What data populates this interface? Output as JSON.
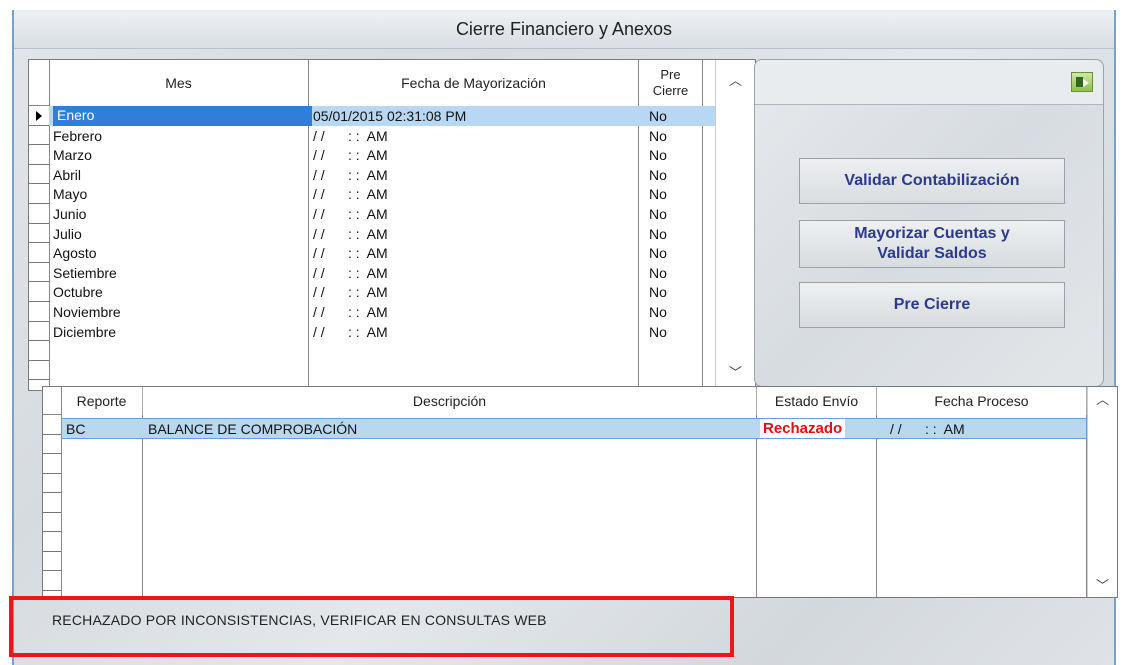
{
  "window": {
    "title": "Cierre Financiero y Anexos"
  },
  "meses_grid": {
    "headers": {
      "mes": "Mes",
      "fecha": "Fecha de Mayorización",
      "pre_cierre": "Pre\nCierre"
    },
    "rows": [
      {
        "mes": "Enero",
        "fecha": "05/01/2015 02:31:08 PM",
        "pre_cierre": "No"
      },
      {
        "mes": "Febrero",
        "fecha": "/ /      : :  AM",
        "pre_cierre": "No"
      },
      {
        "mes": "Marzo",
        "fecha": "/ /      : :  AM",
        "pre_cierre": "No"
      },
      {
        "mes": "Abril",
        "fecha": "/ /      : :  AM",
        "pre_cierre": "No"
      },
      {
        "mes": "Mayo",
        "fecha": "/ /      : :  AM",
        "pre_cierre": "No"
      },
      {
        "mes": "Junio",
        "fecha": "/ /      : :  AM",
        "pre_cierre": "No"
      },
      {
        "mes": "Julio",
        "fecha": "/ /      : :  AM",
        "pre_cierre": "No"
      },
      {
        "mes": "Agosto",
        "fecha": "/ /      : :  AM",
        "pre_cierre": "No"
      },
      {
        "mes": "Setiembre",
        "fecha": "/ /      : :  AM",
        "pre_cierre": "No"
      },
      {
        "mes": "Octubre",
        "fecha": "/ /      : :  AM",
        "pre_cierre": "No"
      },
      {
        "mes": "Noviembre",
        "fecha": "/ /      : :  AM",
        "pre_cierre": "No"
      },
      {
        "mes": "Diciembre",
        "fecha": "/ /      : :  AM",
        "pre_cierre": "No"
      }
    ]
  },
  "actions": {
    "exit_icon": "exit-door-icon",
    "validar": "Validar Contabilización",
    "mayorizar_line1": "Mayorizar Cuentas y",
    "mayorizar_line2": "Validar Saldos",
    "pre_cierre": "Pre Cierre"
  },
  "reportes_grid": {
    "headers": {
      "reporte": "Reporte",
      "descripcion": "Descripción",
      "estado": "Estado Envío",
      "fecha": "Fecha Proceso"
    },
    "rows": [
      {
        "reporte": "BC",
        "descripcion": "BALANCE DE COMPROBACIÓN",
        "estado": "Rechazado",
        "fecha": "/ /      : :  AM"
      }
    ]
  },
  "status_message": "RECHAZADO POR INCONSISTENCIAS, VERIFICAR EN CONSULTAS WEB",
  "colors": {
    "selection": "#b8d7f3",
    "rejected": "#e01010",
    "button_text": "#2c3a8c",
    "highlight_box": "#e81818"
  }
}
